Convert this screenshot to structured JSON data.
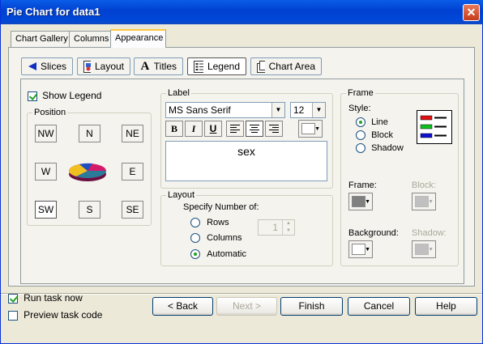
{
  "window": {
    "title": "Pie Chart for data1",
    "close_glyph": "✕"
  },
  "top_tabs": [
    {
      "label": "Chart Gallery",
      "active": false
    },
    {
      "label": "Columns",
      "active": false
    },
    {
      "label": "Appearance",
      "active": true
    }
  ],
  "sub_tabs": [
    {
      "label": "Slices",
      "icon": "slices-icon",
      "active": false
    },
    {
      "label": "Layout",
      "icon": "layout-icon",
      "active": false
    },
    {
      "label": "Titles",
      "icon": "titles-icon",
      "active": false
    },
    {
      "label": "Legend",
      "icon": "legend-icon",
      "active": true
    },
    {
      "label": "Chart Area",
      "icon": "chart-area-icon",
      "active": false
    }
  ],
  "legend": {
    "show_legend": {
      "label": "Show Legend",
      "checked": true
    },
    "position": {
      "label": "Position",
      "buttons": {
        "nw": "NW",
        "n": "N",
        "ne": "NE",
        "w": "W",
        "e": "E",
        "sw": "SW",
        "s": "S",
        "se": "SE"
      },
      "selected": "SW"
    },
    "label": {
      "group_label": "Label",
      "font": "MS Sans Serif",
      "size": "12",
      "format": {
        "bold": "B",
        "italic": "I",
        "underline": "U"
      },
      "text": "sex"
    },
    "layout": {
      "group_label": "Layout",
      "specify_label": "Specify Number of:",
      "options": [
        {
          "label": "Rows",
          "checked": false
        },
        {
          "label": "Columns",
          "checked": false
        },
        {
          "label": "Automatic",
          "checked": true
        }
      ],
      "count": "1"
    },
    "frame": {
      "group_label": "Frame",
      "style_label": "Style:",
      "styles": [
        {
          "label": "Line",
          "checked": true
        },
        {
          "label": "Block",
          "checked": false
        },
        {
          "label": "Shadow",
          "checked": false
        }
      ],
      "frame_label": "Frame:",
      "block_label": "Block:",
      "background_label": "Background:",
      "shadow_label": "Shadow:",
      "colors": {
        "frame": "#808080",
        "block": "#c0c0c0",
        "background": "#ffffff",
        "shadow": "#c0c0c0"
      },
      "preview_colors": [
        "#e01010",
        "#10c020",
        "#1010d0"
      ]
    }
  },
  "pie_colors": [
    "#d41a6a",
    "#2a7a9a",
    "#f0c020",
    "#2050c0"
  ],
  "bottom": {
    "run_task_now": {
      "label": "Run task now",
      "checked": true
    },
    "preview_task_code": {
      "label": "Preview task code",
      "checked": false
    },
    "buttons": {
      "back": "< Back",
      "next": "Next >",
      "finish": "Finish",
      "cancel": "Cancel",
      "help": "Help"
    }
  }
}
